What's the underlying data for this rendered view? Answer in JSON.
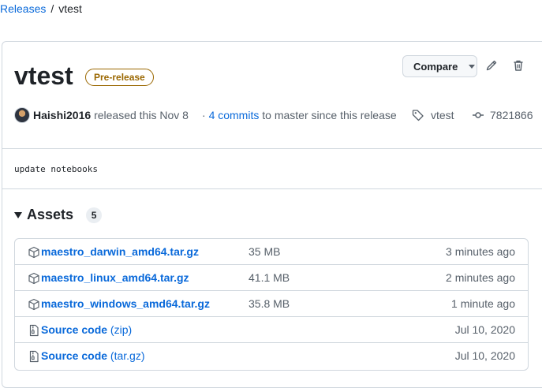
{
  "breadcrumb": {
    "parent": "Releases",
    "separator": "/",
    "current": "vtest"
  },
  "release": {
    "title": "vtest",
    "badge": "Pre-release",
    "compare_label": "Compare",
    "author": "Haishi2016",
    "released_text": "released this Nov 8",
    "commits_prefix": "·",
    "commits_link": "4 commits",
    "commits_suffix": "to master since this release",
    "tag": "vtest",
    "commit_sha": "7821866",
    "notes": "update notebooks"
  },
  "assets": {
    "title": "Assets",
    "count": "5",
    "items": [
      {
        "name": "maestro_darwin_amd64.tar.gz",
        "size": "35 MB",
        "time": "3 minutes ago",
        "icon": "package-icon"
      },
      {
        "name": "maestro_linux_amd64.tar.gz",
        "size": "41.1 MB",
        "time": "2 minutes ago",
        "icon": "package-icon"
      },
      {
        "name": "maestro_windows_amd64.tar.gz",
        "size": "35.8 MB",
        "time": "1 minute ago",
        "icon": "package-icon"
      },
      {
        "name": "Source code",
        "sub": "(zip)",
        "time": "Jul 10, 2020",
        "icon": "file-zip-icon"
      },
      {
        "name": "Source code",
        "sub": "(tar.gz)",
        "time": "Jul 10, 2020",
        "icon": "file-zip-icon"
      }
    ]
  },
  "colors": {
    "link": "#0969da",
    "prerelease": "#9a6700",
    "border": "#d0d7de",
    "muted": "#57606a"
  }
}
